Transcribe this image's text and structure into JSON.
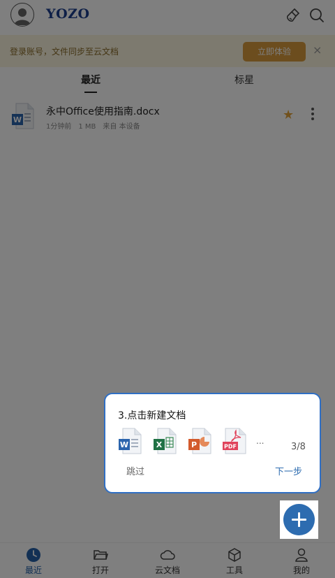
{
  "header": {
    "logo_text": "YOZO",
    "icons": [
      "avatar-icon",
      "clean-icon",
      "search-icon"
    ]
  },
  "banner": {
    "text": "登录账号，文件同步至云文档",
    "button_label": "立即体验",
    "close_glyph": "×"
  },
  "tabs": [
    {
      "label": "最近",
      "active": true
    },
    {
      "label": "标星",
      "active": false
    }
  ],
  "files": [
    {
      "name": "永中Office使用指南.docx",
      "time": "1分钟前",
      "size": "1 MB",
      "source": "来自 本设备",
      "starred": true
    }
  ],
  "guide": {
    "title": "3.点击新建文档",
    "ellipsis": "...",
    "step": "3/8",
    "skip_label": "跳过",
    "next_label": "下一步",
    "doc_icons": [
      "word-icon",
      "excel-icon",
      "ppt-icon",
      "pdf-icon"
    ]
  },
  "bottom_nav": [
    {
      "label": "最近",
      "icon": "clock-icon",
      "active": true
    },
    {
      "label": "打开",
      "icon": "folder-icon",
      "active": false
    },
    {
      "label": "云文档",
      "icon": "cloud-icon",
      "active": false
    },
    {
      "label": "工具",
      "icon": "cube-icon",
      "active": false
    },
    {
      "label": "我的",
      "icon": "person-icon",
      "active": false
    }
  ],
  "colors": {
    "accent": "#2d6cb0",
    "banner_bg": "#fbf4de",
    "banner_button": "#d89a3c",
    "star": "#e2a33a",
    "logo": "#1d3f8f"
  }
}
